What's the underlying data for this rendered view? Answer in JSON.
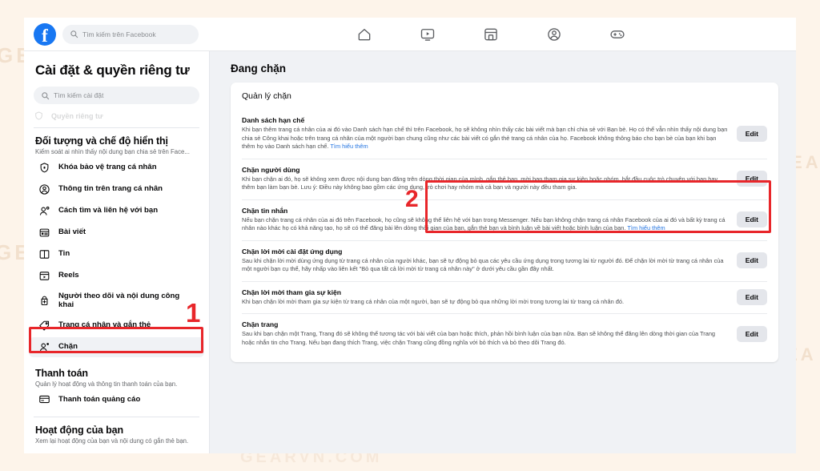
{
  "watermarks": [
    "GEARVN",
    "GEARVN",
    "GEA",
    "GEA",
    "GEARVN.COM",
    "GEA"
  ],
  "topbar": {
    "logo_letter": "f",
    "search_placeholder": "Tìm kiếm trên Facebook",
    "nav_icons": [
      "home-icon",
      "watch-icon",
      "marketplace-icon",
      "groups-icon",
      "gaming-icon"
    ]
  },
  "sidebar": {
    "title": "Cài đặt & quyền riêng tư",
    "search_placeholder": "Tìm kiếm cài đặt",
    "cutoff_item_label": "Quyền riêng tư",
    "sections": [
      {
        "title": "Đối tượng và chế độ hiển thị",
        "subtitle": "Kiểm soát ai nhìn thấy nội dung bạn chia sẻ trên Face...",
        "items": [
          {
            "label": "Khóa bảo vệ trang cá nhân",
            "icon": "shield-lock-icon",
            "selected": false
          },
          {
            "label": "Thông tin trên trang cá nhân",
            "icon": "profile-circle-icon",
            "selected": false
          },
          {
            "label": "Cách tìm và liên hệ với bạn",
            "icon": "person-search-icon",
            "selected": false
          },
          {
            "label": "Bài viết",
            "icon": "post-icon",
            "selected": false
          },
          {
            "label": "Tin",
            "icon": "story-book-icon",
            "selected": false
          },
          {
            "label": "Reels",
            "icon": "reels-icon",
            "selected": false
          },
          {
            "label": "Người theo dõi và nội dung công khai",
            "icon": "followers-add-icon",
            "selected": false
          },
          {
            "label": "Trang cá nhân và gắn thẻ",
            "icon": "tag-icon",
            "selected": false
          },
          {
            "label": "Chặn",
            "icon": "block-person-icon",
            "selected": true
          }
        ]
      },
      {
        "title": "Thanh toán",
        "subtitle": "Quản lý hoạt động và thông tin thanh toán của bạn.",
        "items": [
          {
            "label": "Thanh toán quảng cáo",
            "icon": "credit-card-icon",
            "selected": false
          }
        ]
      },
      {
        "title": "Hoạt động của bạn",
        "subtitle": "Xem lại hoạt động của bạn và nội dung có gắn thẻ bạn.",
        "items": []
      }
    ]
  },
  "main": {
    "title": "Đang chặn",
    "card_title": "Quản lý chặn",
    "edit_label": "Edit",
    "learn_more_label": "Tìm hiểu thêm",
    "blocks": [
      {
        "title": "Danh sách hạn chế",
        "body": "Khi bạn thêm trang cá nhân của ai đó vào Danh sách hạn chế thì trên Facebook, họ sẽ không nhìn thấy các bài viết mà bạn chỉ chia sẻ với Bạn bè. Họ có thể vẫn nhìn thấy nội dung bạn chia sẻ Công khai hoặc trên trang cá nhân của một người bạn chung cũng như các bài viết có gắn thẻ trang cá nhân của họ. Facebook không thông báo cho bạn bè của bạn khi bạn thêm họ vào Danh sách hạn chế.",
        "has_learn_more": true,
        "edit_label": "Edit",
        "highlighted": false
      },
      {
        "title": "Chặn người dùng",
        "body": "Khi bạn chặn ai đó, họ sẽ không xem được nội dung bạn đăng trên dòng thời gian của mình, gắn thẻ bạn, mời bạn tham gia sự kiện hoặc nhóm, bắt đầu cuộc trò chuyện với bạn hay thêm bạn làm bạn bè. Lưu ý: Điều này không bao gồm các ứng dụng, trò chơi hay nhóm mà cả bạn và người này đều tham gia.",
        "has_learn_more": false,
        "edit_label": "Edit",
        "highlighted": true
      },
      {
        "title": "Chặn tin nhắn",
        "body": "Nếu bạn chặn trang cá nhân của ai đó trên Facebook, họ cũng sẽ không thể liên hệ với bạn trong Messenger. Nếu bạn không chặn trang cá nhân Facebook của ai đó và bất kỳ trang cá nhân nào khác họ có khả năng tạo, họ sẽ có thể đăng bài lên dòng thời gian của bạn, gắn thẻ bạn và bình luận về bài viết hoặc bình luận của bạn.",
        "has_learn_more": true,
        "edit_label": "Edit",
        "highlighted": false
      },
      {
        "title": "Chặn lời mời cài đặt ứng dụng",
        "body": "Sau khi chặn lời mời dùng ứng dụng từ trang cá nhân của người khác, bạn sẽ tự động bỏ qua các yêu cầu ứng dụng trong tương lai từ người đó. Để chặn lời mời từ trang cá nhân của một người bạn cụ thể, hãy nhấp vào liên kết \"Bỏ qua tất cả lời mời từ trang cá nhân này\" ở dưới yêu cầu gần đây nhất.",
        "has_learn_more": false,
        "edit_label": "Edit",
        "highlighted": false
      },
      {
        "title": "Chặn lời mời tham gia sự kiện",
        "body": "Khi bạn chặn lời mời tham gia sự kiện từ trang cá nhân của một người, bạn sẽ tự động bỏ qua những lời mời trong tương lai từ trang cá nhân đó.",
        "has_learn_more": false,
        "edit_label": "Edit",
        "highlighted": false
      },
      {
        "title": "Chặn trang",
        "body": "Sau khi bạn chặn một Trang, Trang đó sẽ không thể tương tác với bài viết của bạn hoặc thích, phản hồi bình luận của bạn nữa. Bạn sẽ không thể đăng lên dòng thời gian của Trang hoặc nhắn tin cho Trang. Nếu bạn đang thích Trang, việc chặn Trang cũng đồng nghĩa với bỏ thích và bỏ theo dõi Trang đó.",
        "has_learn_more": false,
        "edit_label": "Edit",
        "highlighted": false
      }
    ]
  },
  "annotations": {
    "marker_1": "1",
    "marker_2": "2",
    "color": "#e8262a"
  }
}
